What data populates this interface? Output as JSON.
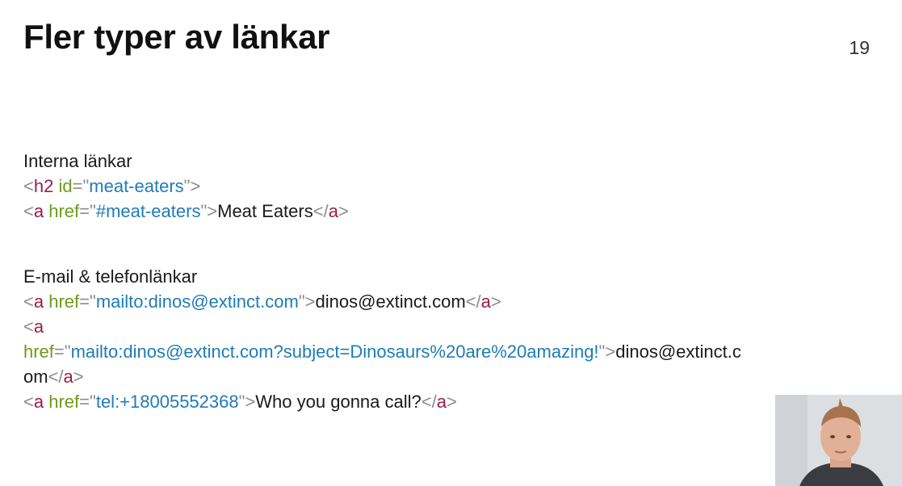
{
  "slide": {
    "title": "Fler typer av länkar",
    "number": "19"
  },
  "sections": [
    {
      "heading": "Interna länkar",
      "lines": [
        [
          {
            "t": "punct",
            "v": "<"
          },
          {
            "t": "tag",
            "v": "h2"
          },
          {
            "t": "text",
            "v": " "
          },
          {
            "t": "attr",
            "v": "id"
          },
          {
            "t": "punct",
            "v": "=\""
          },
          {
            "t": "val",
            "v": "meat-eaters"
          },
          {
            "t": "punct",
            "v": "\">"
          }
        ],
        [
          {
            "t": "punct",
            "v": "<"
          },
          {
            "t": "tag",
            "v": "a"
          },
          {
            "t": "text",
            "v": " "
          },
          {
            "t": "attr",
            "v": "href"
          },
          {
            "t": "punct",
            "v": "=\""
          },
          {
            "t": "val",
            "v": "#meat-eaters"
          },
          {
            "t": "punct",
            "v": "\">"
          },
          {
            "t": "text",
            "v": "Meat Eaters"
          },
          {
            "t": "punct",
            "v": "</"
          },
          {
            "t": "tag",
            "v": "a"
          },
          {
            "t": "punct",
            "v": ">"
          }
        ]
      ]
    },
    {
      "heading": "E-mail & telefonlänkar",
      "lines": [
        [
          {
            "t": "punct",
            "v": "<"
          },
          {
            "t": "tag",
            "v": "a"
          },
          {
            "t": "text",
            "v": " "
          },
          {
            "t": "attr",
            "v": "href"
          },
          {
            "t": "punct",
            "v": "=\""
          },
          {
            "t": "val",
            "v": "mailto:dinos@extinct.com"
          },
          {
            "t": "punct",
            "v": "\">"
          },
          {
            "t": "text",
            "v": "dinos@extinct.com"
          },
          {
            "t": "punct",
            "v": "</"
          },
          {
            "t": "tag",
            "v": "a"
          },
          {
            "t": "punct",
            "v": ">"
          }
        ],
        [
          {
            "t": "punct",
            "v": "<"
          },
          {
            "t": "tag",
            "v": "a"
          }
        ],
        [
          {
            "t": "attr",
            "v": "href"
          },
          {
            "t": "punct",
            "v": "=\""
          },
          {
            "t": "val",
            "v": "mailto:dinos@extinct.com?subject=Dinosaurs%20are%20amazing!"
          },
          {
            "t": "punct",
            "v": "\">"
          },
          {
            "t": "text",
            "v": "dinos@extinct.c"
          }
        ],
        [
          {
            "t": "text",
            "v": "om"
          },
          {
            "t": "punct",
            "v": "</"
          },
          {
            "t": "tag",
            "v": "a"
          },
          {
            "t": "punct",
            "v": ">"
          }
        ],
        [
          {
            "t": "punct",
            "v": "<"
          },
          {
            "t": "tag",
            "v": "a"
          },
          {
            "t": "text",
            "v": " "
          },
          {
            "t": "attr",
            "v": "href"
          },
          {
            "t": "punct",
            "v": "=\""
          },
          {
            "t": "val",
            "v": "tel:+18005552368"
          },
          {
            "t": "punct",
            "v": "\">"
          },
          {
            "t": "text",
            "v": "Who you gonna call?"
          },
          {
            "t": "punct",
            "v": "</"
          },
          {
            "t": "tag",
            "v": "a"
          },
          {
            "t": "punct",
            "v": ">"
          }
        ]
      ]
    }
  ],
  "colors": {
    "punctuation": "#8c8c8c",
    "tag": "#9b1d4a",
    "attribute": "#6e9a1c",
    "value": "#1f7bb6",
    "text": "#1a1a1a"
  },
  "overlay": {
    "icon": "presenter-webcam"
  }
}
